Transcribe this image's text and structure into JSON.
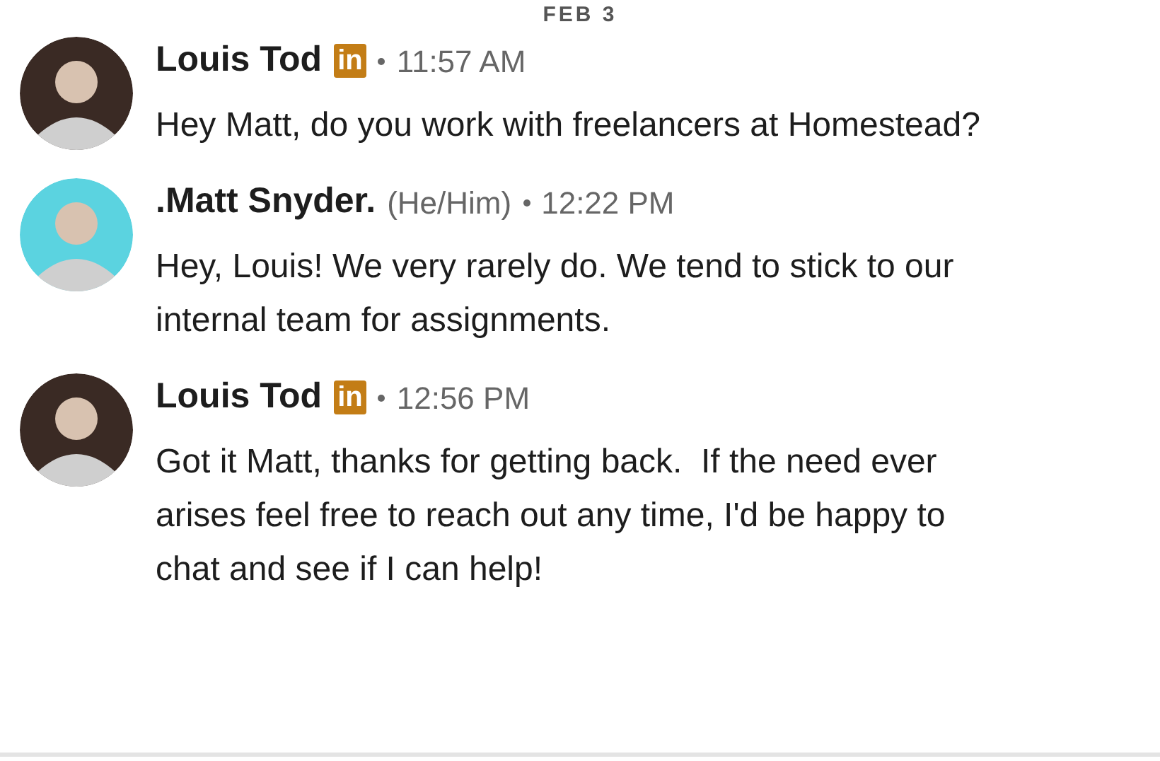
{
  "date_divider": "FEB 3",
  "messages": [
    {
      "sender": "Louis Tod",
      "badge": "in",
      "time": "11:57 AM",
      "color": "#3a2a24",
      "text": "Hey Matt, do you work with freelancers at Homestead?"
    },
    {
      "sender": ".Matt Snyder.",
      "pronouns": "(He/Him)",
      "time": "12:22 PM",
      "color": "#5bd3e0",
      "text": "Hey, Louis! We very rarely do. We tend to stick to our internal team for assignments."
    },
    {
      "sender": "Louis Tod",
      "badge": "in",
      "time": "12:56 PM",
      "color": "#3a2a24",
      "text": "Got it Matt, thanks for getting back.  If the need ever arises feel free to reach out any time, I'd be happy to chat and see if I can help!"
    }
  ]
}
